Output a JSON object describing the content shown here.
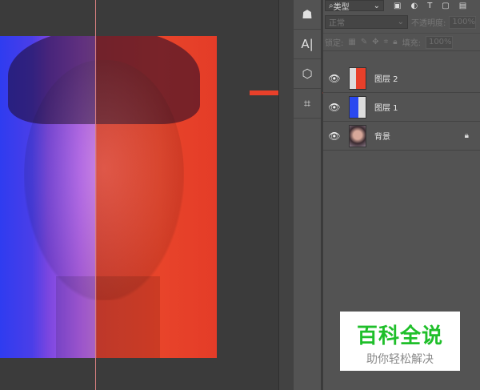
{
  "toolbar": {
    "tools": [
      {
        "icon": "stamp-icon"
      },
      {
        "icon": "type-icon",
        "label": "A|"
      },
      {
        "icon": "3d-icon"
      },
      {
        "icon": "crop-icon"
      }
    ]
  },
  "layers_panel": {
    "filter": "类型",
    "blend_mode": "正常",
    "opacity_label": "不透明度:",
    "opacity_value": "100%",
    "lock_label": "锁定:",
    "fill_label": "填充:",
    "fill_value": "100%",
    "layers": [
      {
        "name": "图层 2",
        "visible": true,
        "color": "#e8402a"
      },
      {
        "name": "图层 1",
        "visible": true,
        "color": "#2a48f0"
      },
      {
        "name": "背景",
        "visible": true,
        "locked": true
      }
    ]
  },
  "watermark": {
    "title": "百科全说",
    "subtitle": "助你轻松解决"
  },
  "colors": {
    "arrow": "#e8402a",
    "watermark_green": "#1fbf2a"
  }
}
